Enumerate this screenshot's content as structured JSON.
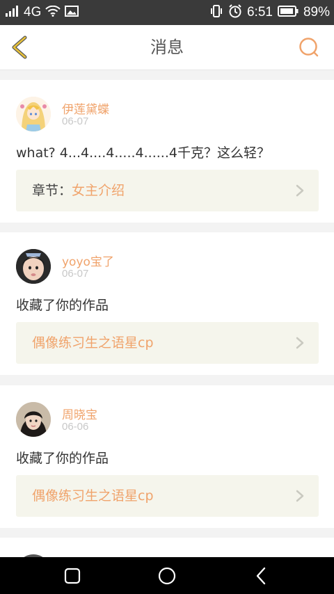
{
  "status_bar": {
    "network": "4G",
    "time": "6:51",
    "battery": "89%"
  },
  "header": {
    "title": "消息"
  },
  "messages": [
    {
      "username": "伊莲黛蝶",
      "date": "06-07",
      "text": "what?  4...4....4.....4......4千克？这么轻？",
      "link_prefix": "章节：",
      "link_title": "女主介绍"
    },
    {
      "username": "yoyo宝了",
      "date": "06-07",
      "text": "收藏了你的作品",
      "link_prefix": "",
      "link_title": "偶像练习生之语星cp"
    },
    {
      "username": "周晓宝",
      "date": "06-06",
      "text": "收藏了你的作品",
      "link_prefix": "",
      "link_title": "偶像练习生之语星cp"
    }
  ],
  "colors": {
    "accent": "#f0a36b",
    "back_arrow": "#e8c23a",
    "link_bg": "#f5f5ec"
  },
  "icons": {
    "back": "chevron-left-icon",
    "search": "search-icon",
    "link_arrow": "chevron-right-icon",
    "nav_recent": "square-icon",
    "nav_home": "circle-icon",
    "nav_back": "triangle-back-icon"
  }
}
